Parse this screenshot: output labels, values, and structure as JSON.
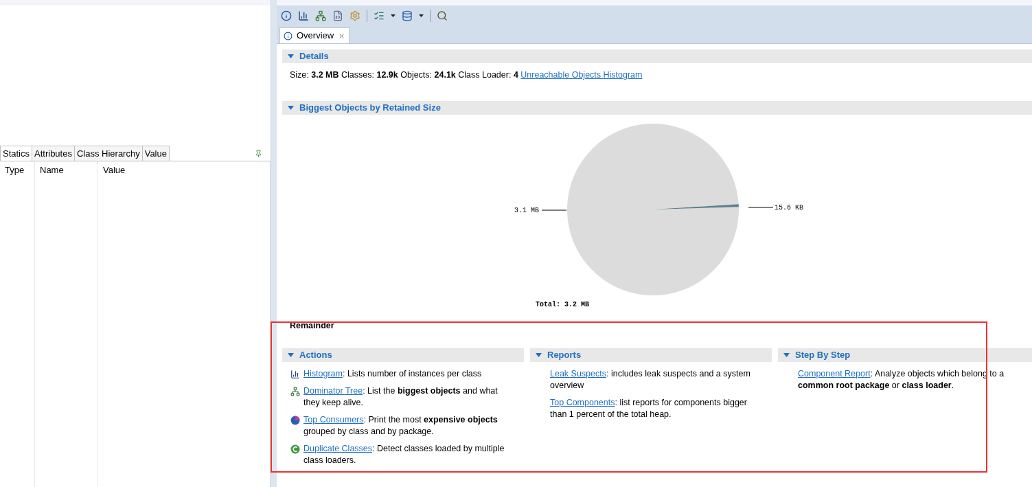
{
  "left_panel": {
    "tabs": [
      {
        "label": "Statics",
        "selected": true
      },
      {
        "label": "Attributes",
        "selected": false
      },
      {
        "label": "Class Hierarchy",
        "selected": false
      },
      {
        "label": "Value",
        "selected": false
      }
    ],
    "columns": [
      "Type",
      "Name",
      "Value"
    ]
  },
  "editor_tab": {
    "label": "Overview",
    "selected": true
  },
  "details": {
    "title": "Details",
    "expanded": true,
    "text": "Size: **3.2 MB** Classes: **12.9k** Objects: **24.1k** Class Loader: **4**",
    "link": "Unreachable Objects Histogram"
  },
  "biggest_objects": {
    "title": "Biggest Objects by Retained Size",
    "expanded": true,
    "chart_data": {
      "type": "pie",
      "values": [
        99.51,
        0.49
      ]
    },
    "slice_labels": [
      "3.1 MB",
      "15.6 KB"
    ],
    "total": "Total: 3.2 MB",
    "remainder_title": "Remainder"
  },
  "sections": [
    {
      "title": "Actions",
      "expanded": true,
      "items": [
        {
          "kind": "histogram",
          "link": "Histogram",
          "text": ": Lists number of instances per class"
        },
        {
          "kind": "tree",
          "link": "Dominator Tree",
          "text": ": List the **biggest objects** and what they keep alive."
        },
        {
          "kind": "consumers",
          "link": "Top Consumers",
          "text": ": Print the most **expensive objects** grouped by class and by package."
        },
        {
          "kind": "duplicates",
          "link": "Duplicate Classes",
          "text": ": Detect classes loaded by multiple class loaders."
        }
      ]
    },
    {
      "title": "Reports",
      "expanded": true,
      "items": [
        {
          "kind": "plain",
          "link": "Leak Suspects",
          "text": ": includes leak suspects and a system overview"
        },
        {
          "kind": "plain",
          "link": "Top Components",
          "text": ": list reports for components bigger than 1 percent of the total heap."
        }
      ]
    },
    {
      "title": "Step By Step",
      "expanded": true,
      "items": [
        {
          "kind": "plain",
          "link": "Component Report",
          "text": ": Analyze objects which belong to a **common root package** or **class loader**."
        }
      ]
    }
  ]
}
